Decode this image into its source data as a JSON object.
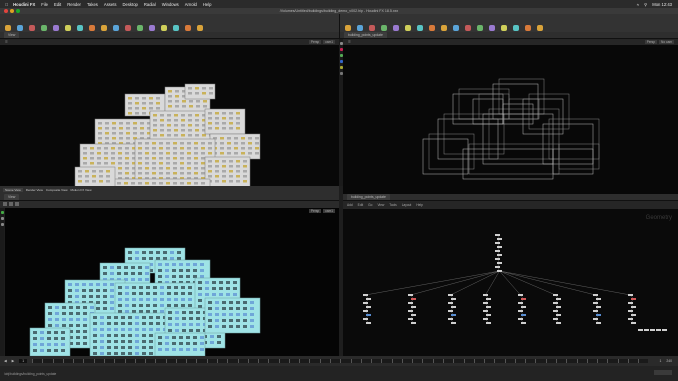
{
  "menubar": {
    "app_name": "Houdini FX",
    "items": [
      "File",
      "Edit",
      "Render",
      "Takes",
      "Assets",
      "Desktop",
      "Radial",
      "Windows",
      "Arnold",
      "Help"
    ],
    "clock": "Mon 12:43"
  },
  "window": {
    "title": "/Volumes/Untitled/buildings/building_demo_v002.hip - Houdini FX 18.5.xxx"
  },
  "shelf_left": {
    "tools": [
      "Box",
      "Sphere",
      "Tube",
      "Torus",
      "Grid",
      "Null",
      "Line",
      "Circle",
      "Curve",
      "Path",
      "Spray Paint",
      "Draw Curve",
      "Platonic",
      "L-System",
      "Metaball",
      "File",
      "Font"
    ]
  },
  "shelf_right": {
    "tools": [
      "Camera",
      "Point Light",
      "Spot Light",
      "Area Light",
      "Geo Light",
      "Volume Light",
      "Distant",
      "Environment",
      "Sky Light",
      "GI Light",
      "Caustic",
      "Portal",
      "Ambient",
      "Stereo Cam",
      "VR Camera",
      "Switcher",
      "Gamepad"
    ]
  },
  "panes": {
    "top_left": {
      "tab": "View",
      "controls": [
        "Persp",
        "cam1"
      ]
    },
    "top_right": {
      "tab": "building_points_update",
      "controls": [
        "Persp",
        "No cam"
      ]
    },
    "bottom_left": {
      "tab": "View",
      "controls": [
        "Persp",
        "cam1"
      ]
    },
    "bottom_right": {
      "tab": "building_points_update",
      "menu": [
        "Add",
        "Edit",
        "Go",
        "View",
        "Tools",
        "Layout",
        "Help"
      ],
      "context_label": "Geometry"
    },
    "mid_left_tabs": [
      "Scene View",
      "Render View",
      "Composite View",
      "Motion FX View"
    ]
  },
  "timeline": {
    "frame": "1",
    "start": "1",
    "end": "240"
  },
  "status": {
    "text": "/obj/buildings/building_points_update"
  },
  "colors": {
    "accent_blue": "#3f8fd0",
    "viewport_bg": "#080808",
    "building_white": "#d9d9d9",
    "window_yellow": "#c9b25a",
    "building_cyan": "#9fe3e6",
    "window_blue": "#6fa6d8"
  }
}
